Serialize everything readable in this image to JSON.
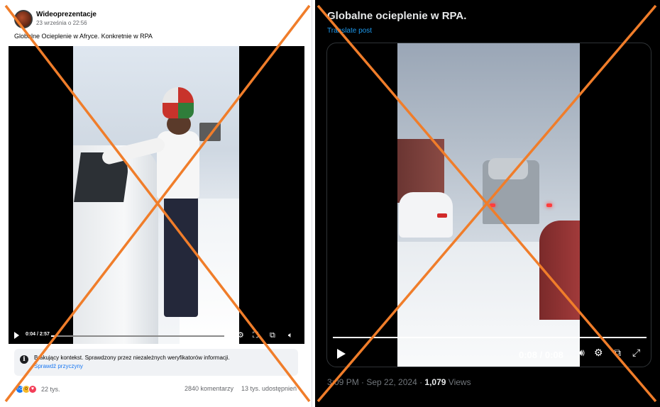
{
  "left_post": {
    "page_name": "Wideoprezentacje",
    "date": "23 września o 22:56",
    "caption": "Globalne Ocieplenie w Afryce. Konkretnie w RPA",
    "video": {
      "time": "0:04 / 2:57",
      "progress": 0.02
    },
    "context": {
      "text": "Brakujący kontekst. Sprawdzony przez niezależnych weryfikatorów informacji.",
      "link": "Sprawdź przyczyny"
    },
    "reactions": {
      "count": "22 tys.",
      "icons": [
        "like-icon",
        "wow-icon",
        "love-icon"
      ]
    },
    "comments": "2840 komentarzy",
    "shares": "13 tys. udostępnień"
  },
  "right_post": {
    "title": "Globalne ocieplenie w RPA.",
    "translate": "Translate post",
    "video": {
      "time": "0:08 / 0:08",
      "progress": 1.0
    },
    "meta_time": "3:09 PM · Sep 22, 2024 · ",
    "views_count": "1,079",
    "views_label": " Views"
  },
  "colors": {
    "cross": "#f07d2a",
    "fb_link": "#1877f2",
    "tw_link": "#1d9bf0"
  }
}
